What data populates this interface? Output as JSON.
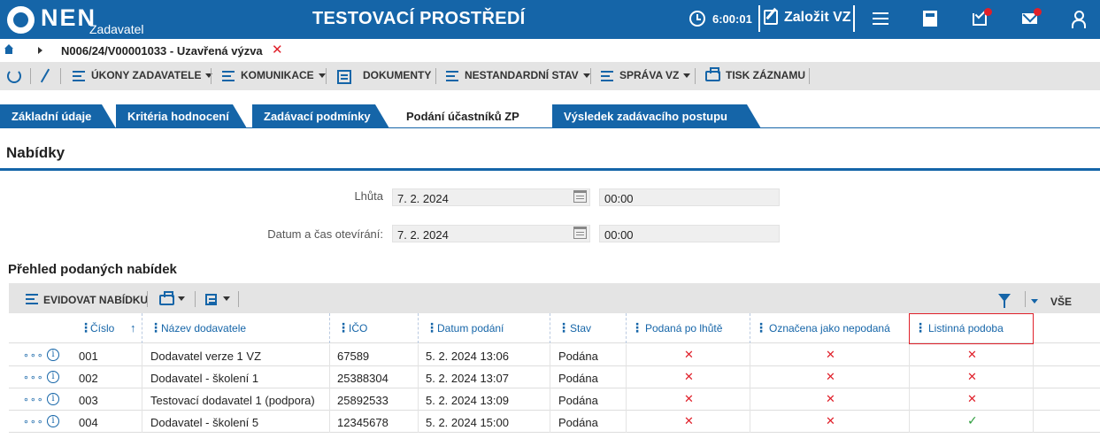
{
  "header": {
    "logo": "NEN",
    "logo_sub": "Zadavatel",
    "title": "TESTOVACÍ PROSTŘEDÍ",
    "timer": "6:00:01",
    "create_label": "Založit VZ"
  },
  "breadcrumb": {
    "item": "N006/24/V00001033 - Uzavřená výzva"
  },
  "toolbar": {
    "ukony": "ÚKONY ZADAVATELE",
    "komunikace": "KOMUNIKACE",
    "dokumenty": "DOKUMENTY",
    "nestandardni": "NESTANDARDNÍ STAV",
    "sprava": "SPRÁVA VZ",
    "tisk": "TISK ZÁZNAMU"
  },
  "tabs": [
    {
      "label": "Základní údaje"
    },
    {
      "label": "Kritéria hodnocení"
    },
    {
      "label": "Zadávací podmínky"
    },
    {
      "label": "Podání účastníků ZP"
    },
    {
      "label": "Výsledek zadávacího postupu"
    }
  ],
  "section": {
    "title": "Nabídky",
    "lhuta_label": "Lhůta",
    "lhuta_date": "7. 2. 2024",
    "lhuta_time": "00:00",
    "otevirani_label": "Datum a čas otevírání:",
    "otevirani_date": "7. 2. 2024",
    "otevirani_time": "00:00"
  },
  "grid": {
    "title": "Přehled podaných nabídek",
    "evidovat_label": "EVIDOVAT NABÍDKU",
    "vse_label": "VŠE",
    "columns": {
      "cislo": "Číslo",
      "nazev": "Název dodavatele",
      "ico": "IČO",
      "datum": "Datum podání",
      "stav": "Stav",
      "po_lhute": "Podaná po lhůtě",
      "nepodana": "Označena jako nepodaná",
      "listinna": "Listinná podoba"
    },
    "rows": [
      {
        "cislo": "001",
        "nazev": "Dodavatel verze 1 VZ",
        "ico": "67589",
        "datum": "5. 2. 2024 13:06",
        "stav": "Podána",
        "po_lhute": "✕",
        "nepodana": "✕",
        "listinna": "✕"
      },
      {
        "cislo": "002",
        "nazev": "Dodavatel - školení 1",
        "ico": "25388304",
        "datum": "5. 2. 2024 13:07",
        "stav": "Podána",
        "po_lhute": "✕",
        "nepodana": "✕",
        "listinna": "✕"
      },
      {
        "cislo": "003",
        "nazev": "Testovací dodavatel 1 (podpora)",
        "ico": "25892533",
        "datum": "5. 2. 2024 13:09",
        "stav": "Podána",
        "po_lhute": "✕",
        "nepodana": "✕",
        "listinna": "✕"
      },
      {
        "cislo": "004",
        "nazev": "Dodavatel - školení 5",
        "ico": "12345678",
        "datum": "5. 2. 2024 15:00",
        "stav": "Podána",
        "po_lhute": "✕",
        "nepodana": "✕",
        "listinna": "✓"
      }
    ]
  }
}
